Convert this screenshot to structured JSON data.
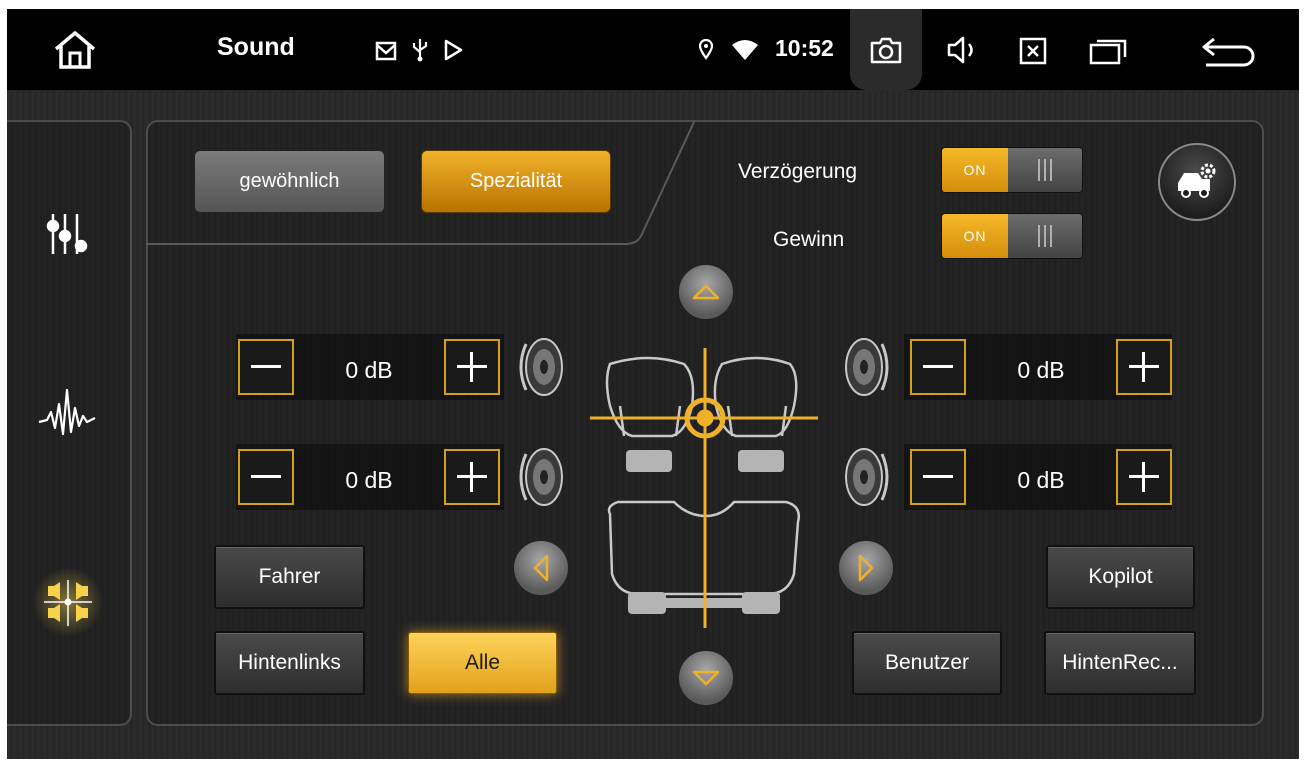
{
  "statusbar": {
    "title": "Sound",
    "time": "10:52",
    "icons": [
      "home-icon",
      "gmail-icon",
      "usb-icon",
      "play-store-icon",
      "location-icon",
      "wifi-icon",
      "camera-icon",
      "volume-icon",
      "close-window-icon",
      "recent-apps-icon",
      "back-icon"
    ]
  },
  "sidebar": {
    "items": [
      {
        "icon": "equalizer-icon",
        "active": false
      },
      {
        "icon": "waveform-icon",
        "active": false
      },
      {
        "icon": "balance-fader-icon",
        "active": true
      }
    ]
  },
  "mode": {
    "normal_label": "gewöhnlich",
    "special_label": "Spezialität",
    "selected": "Spezialität"
  },
  "settings": {
    "delay_label": "Verzögerung",
    "delay_state": "ON",
    "gain_label": "Gewinn",
    "gain_state": "ON"
  },
  "speakers": {
    "front_left_db": "0 dB",
    "front_right_db": "0 dB",
    "rear_left_db": "0 dB",
    "rear_right_db": "0 dB"
  },
  "positions": {
    "driver": "Fahrer",
    "copilot": "Kopilot",
    "rear_left": "Hintenlinks",
    "all": "Alle",
    "user": "Benutzer",
    "rear_right": "HintenRec...",
    "selected": "Alle"
  },
  "colors": {
    "accent": "#f0b12a",
    "background": "#1c1c1c",
    "statusbar": "#000000"
  }
}
